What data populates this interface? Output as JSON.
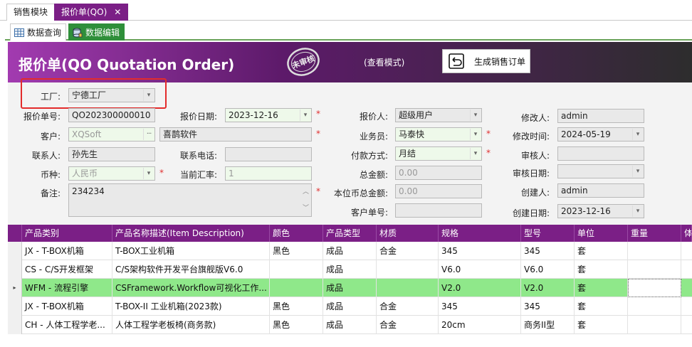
{
  "tabs": [
    {
      "label": "销售模块"
    },
    {
      "label": "报价单(QO)",
      "close": "✕"
    }
  ],
  "subtabs": [
    {
      "label": "数据查询"
    },
    {
      "label": "数据编辑"
    }
  ],
  "header": {
    "title": "报价单(QO Quotation Order)",
    "mode": "(查看模式)",
    "generate_button": "生成销售订单",
    "stamp_text": "未审核"
  },
  "form": {
    "factory_label": "工厂:",
    "factory_value": "宁德工厂",
    "quote_no_label": "报价单号:",
    "quote_no_value": "QO202300000010",
    "quote_date_label": "报价日期:",
    "quote_date_value": "2023-12-16",
    "quoter_label": "报价人:",
    "quoter_value": "超级用户",
    "modifier_label": "修改人:",
    "modifier_value": "admin",
    "customer_label": "客户:",
    "customer_code": "XQSoft",
    "customer_name": "喜鹊软件",
    "salesman_label": "业务员:",
    "salesman_value": "马泰快",
    "modify_time_label": "修改时间:",
    "modify_time_value": "2024-05-19",
    "contact_label": "联系人:",
    "contact_value": "孙先生",
    "phone_label": "联系电话:",
    "phone_value": "",
    "payment_label": "付款方式:",
    "payment_value": "月结",
    "auditor_label": "审核人:",
    "auditor_value": "",
    "currency_label": "币种:",
    "currency_value": "人民币",
    "rate_label": "当前汇率:",
    "rate_value": "1",
    "total_label": "总金额:",
    "total_value": "0.00",
    "audit_date_label": "审核日期:",
    "audit_date_value": "",
    "remark_label": "备注:",
    "remark_value": "234234",
    "base_total_label": "本位币总金额:",
    "base_total_value": "0.00",
    "creator_label": "创建人:",
    "creator_value": "admin",
    "cust_order_label": "客户单号:",
    "cust_order_value": "",
    "create_date_label": "创建日期:",
    "create_date_value": "2023-12-16",
    "required_mark": "*"
  },
  "grid": {
    "columns": [
      "产品类别",
      "产品名称描述(Item Description)",
      "颜色",
      "产品类型",
      "材质",
      "规格",
      "型号",
      "单位",
      "重量",
      "体"
    ],
    "rows": [
      [
        "JX - T-BOX机箱",
        "T-BOX工业机箱",
        "黑色",
        "成品",
        "合金",
        "345",
        "345",
        "套",
        ""
      ],
      [
        "CS - C/S开发框架",
        "C/S架构软件开发平台旗舰版V6.0",
        "",
        "成品",
        "",
        "V6.0",
        "V6.0",
        "套",
        ""
      ],
      [
        "WFM - 流程引擎",
        "CSFramework.Workflow可视化工作...",
        "",
        "成品",
        "",
        "V2.0",
        "V2.0",
        "套",
        ""
      ],
      [
        "JX - T-BOX机箱",
        "T-BOX-II 工业机箱(2023款)",
        "黑色",
        "成品",
        "合金",
        "345",
        "345",
        "套",
        ""
      ],
      [
        "CH - 人体工程学老...",
        "人体工程学老板椅(商务款)",
        "黑色",
        "成品",
        "合金",
        "20cm",
        "商务II型",
        "套",
        ""
      ]
    ],
    "selected_row": 2,
    "row_pointer": "▸"
  },
  "colors": {
    "accent": "#7b1f86",
    "selected_row": "#8fe88a",
    "required": "#e03030",
    "active_subtab": "#2f8f3a"
  }
}
